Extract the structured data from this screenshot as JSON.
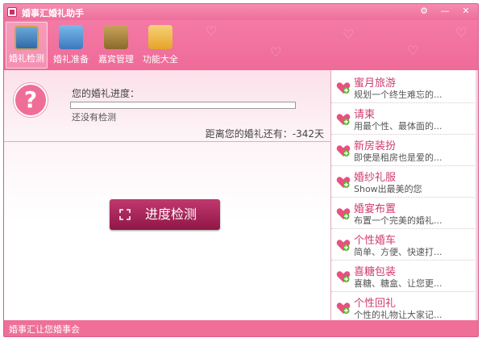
{
  "window": {
    "title": "婚事汇婚礼助手",
    "controls": [
      "⚙",
      "—",
      "✕"
    ]
  },
  "toolbar": {
    "items": [
      {
        "label": "婚礼检测",
        "icon": "portrait-icon",
        "active": true
      },
      {
        "label": "婚礼准备",
        "icon": "checklist-icon",
        "active": false
      },
      {
        "label": "嘉宾管理",
        "icon": "guest-book-icon",
        "active": false
      },
      {
        "label": "功能大全",
        "icon": "folder-icon",
        "active": false
      }
    ]
  },
  "progress": {
    "label": "您的婚礼进度：",
    "value": 0,
    "status": "还没有检测",
    "days_text": "距离您的婚礼还有：-342天"
  },
  "check_button": {
    "label": "进度检测"
  },
  "side_list": [
    {
      "title": "蜜月旅游",
      "desc": "规划一个终生难忘的..."
    },
    {
      "title": "请柬",
      "desc": "用最个性、最体面的..."
    },
    {
      "title": "新房装扮",
      "desc": "即使是租房也是爱的..."
    },
    {
      "title": "婚纱礼服",
      "desc": "Show出最美的您"
    },
    {
      "title": "婚宴布置",
      "desc": "布置一个完美的婚礼..."
    },
    {
      "title": "个性婚车",
      "desc": "简单、方便、快速打..."
    },
    {
      "title": "喜糖包装",
      "desc": "喜糖、糖盒、让您更..."
    },
    {
      "title": "个性回礼",
      "desc": "个性的礼物让大家记..."
    }
  ],
  "statusbar": {
    "text": "婚事汇让您婚事会"
  },
  "colors": {
    "accent": "#ef6e98",
    "button": "#a5245a",
    "item_title": "#d13a72"
  }
}
